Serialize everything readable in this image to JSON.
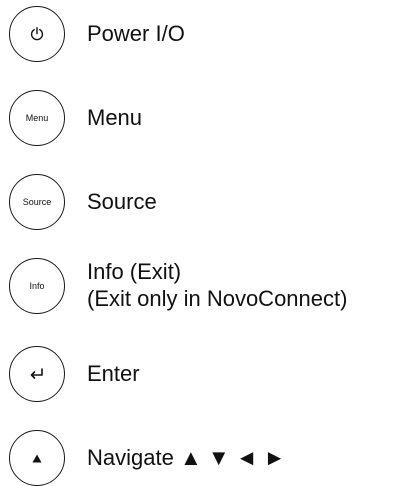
{
  "buttons": [
    {
      "icon": "power-icon",
      "label": "Power I/O"
    },
    {
      "button_text": "Menu",
      "label": "Menu"
    },
    {
      "button_text": "Source",
      "label": "Source"
    },
    {
      "button_text": "Info",
      "label_line1": "Info (Exit)",
      "label_line2": "(Exit only in NovoConnect)"
    },
    {
      "icon": "enter-return-icon",
      "label": "Enter"
    },
    {
      "icon": "navigate-up-triangle-icon",
      "label": "Navigate ▲ ▼ ◄ ►"
    }
  ]
}
